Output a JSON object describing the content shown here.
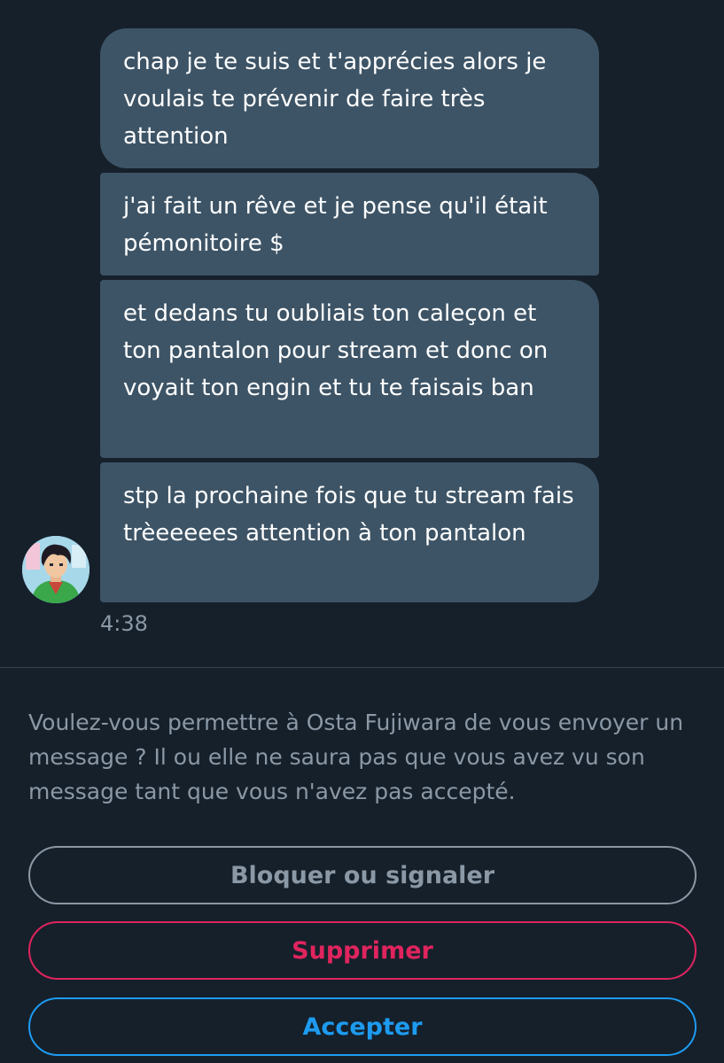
{
  "conversation": {
    "messages": [
      {
        "text": "chap je te suis et t'apprécies alors je voulais te prévenir de faire très attention"
      },
      {
        "text": "j'ai fait un rêve et je pense qu'il était pémonitoire $"
      },
      {
        "text": "et dedans tu oubliais ton caleçon et ton pantalon pour stream et donc on voyait ton engin et tu te faisais ban"
      },
      {
        "text": "stp la prochaine fois que tu stream fais trèeeeees attention à ton pantalon"
      }
    ],
    "timestamp": "4:38",
    "avatar_icon": "user-avatar-icon"
  },
  "message_request": {
    "prompt": "Voulez-vous permettre à Osta Fujiwara de vous envoyer un message ? Il ou elle ne saura pas que vous avez vu son message tant que vous n'avez pas accepté.",
    "block_label": "Bloquer ou signaler",
    "delete_label": "Supprimer",
    "accept_label": "Accepter"
  },
  "colors": {
    "background": "#15202b",
    "bubble": "#3d5466",
    "muted": "#8b98a5",
    "danger": "#e0245e",
    "accent": "#1d9bf0"
  }
}
